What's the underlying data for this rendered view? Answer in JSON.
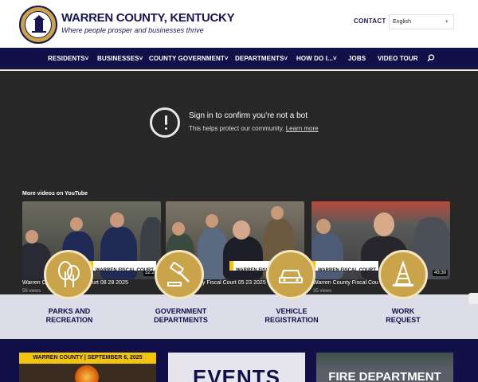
{
  "header": {
    "site_title": "WARREN COUNTY, KENTUCKY",
    "tagline": "Where people prosper and businesses thrive",
    "contact": "CONTACT",
    "language": "English"
  },
  "nav": {
    "items": [
      {
        "label": "RESIDENTS˅"
      },
      {
        "label": "BUSINESSES˅"
      },
      {
        "label": "COUNTY GOVERNMENT˅"
      },
      {
        "label": "DEPARTMENTS˅"
      },
      {
        "label": "HOW DO I...˅"
      },
      {
        "label": "JOBS"
      },
      {
        "label": "VIDEO TOUR"
      }
    ]
  },
  "video": {
    "title": "Sign in to confirm you’re not a bot",
    "subtitle": "This helps protect our community.",
    "learn_more": "Learn more",
    "more_videos": "More videos on YouTube",
    "thumbnails": [
      {
        "caption": "Warren C",
        "caption_tail": "urt 08 28 2025",
        "views": "56 views",
        "duration": "32:24",
        "overlay": ""
      },
      {
        "caption": "",
        "caption_tail": "ty Fiscal Court 05 23 2025",
        "views": "",
        "duration": "",
        "overlay": "WARREN FISCAL COURT"
      },
      {
        "caption": "Warren County Fiscal Cou",
        "caption_tail": "",
        "views": "35 views",
        "duration": "43:30",
        "overlay": "WARREN FISCAL COURT"
      }
    ],
    "thumb1_overlay": "WARREN FISCAL COURT"
  },
  "quick_links": [
    {
      "line1": "PARKS AND",
      "line2": "RECREATION",
      "icon": "tree-icon"
    },
    {
      "line1": "GOVERNMENT",
      "line2": "DEPARTMENTS",
      "icon": "gavel-icon"
    },
    {
      "line1": "VEHICLE",
      "line2": "REGISTRATION",
      "icon": "car-icon"
    },
    {
      "line1": "WORK",
      "line2": "REQUEST",
      "icon": "traffic-cone-icon"
    }
  ],
  "cards": {
    "card1": "WARREN COUNTY | SEPTEMBER 6, 2025",
    "card2": "EVENTS",
    "card3": "FIRE DEPARTMENT"
  },
  "colors": {
    "navy": "#121048",
    "gold": "#c9a44a",
    "video_bg": "#272727"
  }
}
